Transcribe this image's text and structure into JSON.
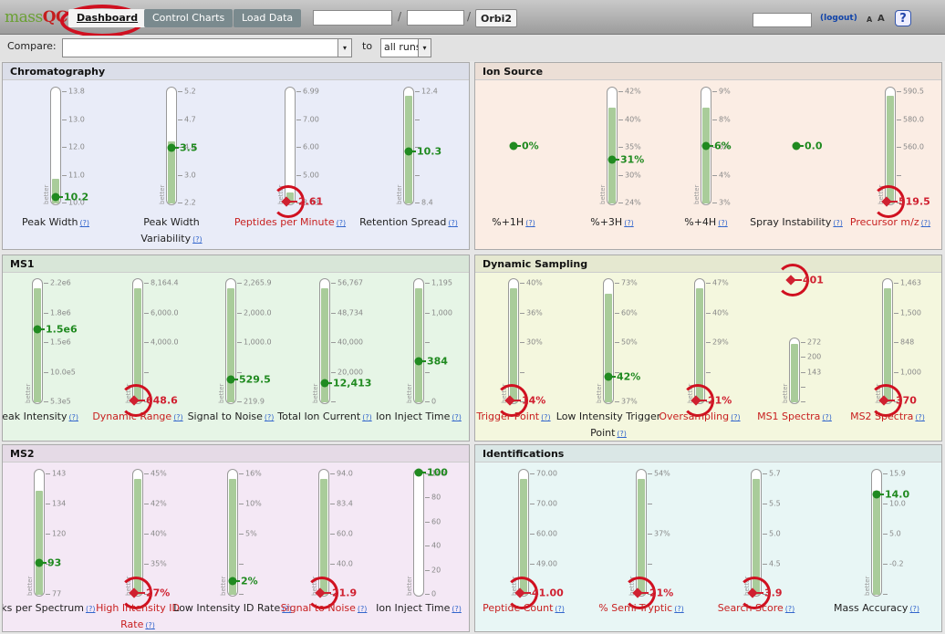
{
  "app": {
    "logo_a": "mass",
    "logo_b": "QC"
  },
  "nav": {
    "dashboard": "Dashboard",
    "control_charts": "Control Charts",
    "load_data": "Load Data",
    "sep": "/",
    "instrument": "Orbi2",
    "logout": "(logout)",
    "font_small": "A",
    "font_large": "A",
    "help": "?"
  },
  "compare": {
    "label": "Compare:",
    "to": "to",
    "runs": "all runs",
    "dd": "▾"
  },
  "panels": [
    {
      "title": "Chromatography",
      "metrics": [
        {
          "label": "Peak Width",
          "ticks": [
            "13.8",
            "13.0",
            "12.0",
            "11.0",
            "10.0"
          ],
          "value": "10.2",
          "fill": 0.22,
          "pos": 0.96,
          "status": "good"
        },
        {
          "label": "Peak Width Variability",
          "ticks": [
            "5.2",
            "4.7",
            "4.0",
            "3.0",
            "2.2"
          ],
          "value": "3.5",
          "fill": 0.55,
          "pos": 0.52,
          "status": "good"
        },
        {
          "label": "Peptides per Minute",
          "ticks": [
            "6.99",
            "7.00",
            "6.00",
            "5.00",
            "3.63"
          ],
          "value": "2.61",
          "fill": 0.1,
          "pos": 1.0,
          "status": "bad"
        },
        {
          "label": "Retention Spread",
          "ticks": [
            "12.4",
            "",
            "",
            "",
            "8.4"
          ],
          "value": "10.3",
          "fill": 0.95,
          "pos": 0.55,
          "status": "good"
        }
      ]
    },
    {
      "title": "Ion Source",
      "metrics": [
        {
          "label": "%+1H",
          "ticks": [],
          "value": "0%",
          "fill": 0,
          "pos": 0.5,
          "status": "flat"
        },
        {
          "label": "%+3H",
          "ticks": [
            "42%",
            "40%",
            "35%",
            "30%",
            "24%"
          ],
          "value": "31%",
          "fill": 0.85,
          "pos": 0.62,
          "status": "good"
        },
        {
          "label": "%+4H",
          "ticks": [
            "9%",
            "8%",
            "6%",
            "4%",
            "3%"
          ],
          "value": "6%",
          "fill": 0.85,
          "pos": 0.5,
          "status": "good"
        },
        {
          "label": "Spray Instability",
          "ticks": [],
          "value": "0.0",
          "fill": 0,
          "pos": 0.5,
          "status": "flat"
        },
        {
          "label": "Precursor m/z",
          "ticks": [
            "590.5",
            "580.0",
            "560.0",
            "",
            ""
          ],
          "value": "519.5",
          "fill": 0.95,
          "pos": 1.0,
          "status": "bad"
        }
      ]
    },
    {
      "title": "MS1",
      "metrics": [
        {
          "label": "Peak Intensity",
          "ticks": [
            "2.2e6",
            "1.8e6",
            "1.5e6",
            "10.0e5",
            "5.3e5"
          ],
          "value": "1.5e6",
          "fill": 0.95,
          "pos": 0.4,
          "status": "good"
        },
        {
          "label": "Dynamic Range",
          "ticks": [
            "8,164.4",
            "6,000.0",
            "4,000.0",
            "",
            ""
          ],
          "value": "648.6",
          "fill": 0.95,
          "pos": 1.0,
          "status": "bad"
        },
        {
          "label": "Signal to Noise",
          "ticks": [
            "2,265.9",
            "2,000.0",
            "1,000.0",
            "",
            "219.9"
          ],
          "value": "529.5",
          "fill": 0.95,
          "pos": 0.82,
          "status": "good"
        },
        {
          "label": "Total Ion Current",
          "ticks": [
            "56,767",
            "48,734",
            "40,000",
            "20,000",
            ""
          ],
          "value": "12,413",
          "fill": 0.95,
          "pos": 0.85,
          "status": "good"
        },
        {
          "label": "Ion Inject Time",
          "ticks": [
            "1,195",
            "1,000",
            "",
            "",
            "0"
          ],
          "value": "384",
          "fill": 0.95,
          "pos": 0.67,
          "status": "good"
        }
      ]
    },
    {
      "title": "Dynamic Sampling",
      "metrics": [
        {
          "label": "Trigger Point",
          "ticks": [
            "40%",
            "36%",
            "30%",
            "",
            ""
          ],
          "value": "14%",
          "fill": 0.95,
          "pos": 1.0,
          "status": "bad"
        },
        {
          "label": "Low Intensity Trigger Point",
          "ticks": [
            "73%",
            "60%",
            "50%",
            "",
            "37%"
          ],
          "value": "42%",
          "fill": 0.9,
          "pos": 0.8,
          "status": "good"
        },
        {
          "label": "Oversampling",
          "ticks": [
            "47%",
            "40%",
            "29%",
            "",
            ""
          ],
          "value": "21%",
          "fill": 0.95,
          "pos": 1.0,
          "status": "bad"
        },
        {
          "label": "MS1 Spectra",
          "ticks": [
            "272",
            "200",
            "143",
            "",
            ""
          ],
          "value": "401",
          "fill": 0.95,
          "pos": -1,
          "status": "bad"
        },
        {
          "label": "MS2 Spectra",
          "ticks": [
            "1,463",
            "1,500",
            "848",
            "1,000",
            ""
          ],
          "value": "370",
          "fill": 0.95,
          "pos": 1.0,
          "status": "bad"
        }
      ]
    },
    {
      "title": "MS2",
      "metrics": [
        {
          "label": "Peaks per Spectrum",
          "ticks": [
            "143",
            "134",
            "120",
            "",
            "77"
          ],
          "value": "93",
          "fill": 0.85,
          "pos": 0.75,
          "status": "good"
        },
        {
          "label": "High Intensity ID Rate",
          "ticks": [
            "45%",
            "42%",
            "40%",
            "35%",
            ""
          ],
          "value": "27%",
          "fill": 0.95,
          "pos": 1.0,
          "status": "bad"
        },
        {
          "label": "Low Intensity ID Rate",
          "ticks": [
            "16%",
            "10%",
            "5%",
            "",
            ""
          ],
          "value": "2%",
          "fill": 0.95,
          "pos": 0.9,
          "status": "good"
        },
        {
          "label": "Signal to Noise",
          "ticks": [
            "94.0",
            "83.4",
            "60.0",
            "40.0",
            ""
          ],
          "value": "21.9",
          "fill": 0.95,
          "pos": 1.0,
          "status": "bad"
        },
        {
          "label": "Ion Inject Time",
          "ticks": [
            "100",
            "80",
            "60",
            "40",
            "20",
            "0"
          ],
          "value": "100",
          "fill": 0,
          "pos": 0.0,
          "status": "good"
        }
      ]
    },
    {
      "title": "Identifications",
      "metrics": [
        {
          "label": "Peptide Count",
          "ticks": [
            "70.00",
            "70.00",
            "60.00",
            "49.00",
            ""
          ],
          "value": "41.00",
          "fill": 0.95,
          "pos": 1.0,
          "status": "bad"
        },
        {
          "label": "% Semi-Tryptic",
          "ticks": [
            "54%",
            "",
            "37%",
            "",
            ""
          ],
          "value": "21%",
          "fill": 0.95,
          "pos": 1.0,
          "status": "bad"
        },
        {
          "label": "Search Score",
          "ticks": [
            "5.7",
            "5.5",
            "5.0",
            "4.5",
            ""
          ],
          "value": "3.9",
          "fill": 0.95,
          "pos": 1.0,
          "status": "bad"
        },
        {
          "label": "Mass Accuracy",
          "ticks": [
            "15.9",
            "10.0",
            "5.0",
            "-0.2",
            ""
          ],
          "value": "14.0",
          "fill": 0.85,
          "pos": 0.18,
          "status": "good"
        }
      ]
    }
  ],
  "help_link": "(?)",
  "better": "better",
  "colors": {
    "chrom": "#e9ecf8",
    "ion": "#fbede4",
    "ms1": "#e6f5e6",
    "dyn": "#f4f7de",
    "ms2": "#f4e8f5",
    "ids": "#e8f6f5"
  }
}
